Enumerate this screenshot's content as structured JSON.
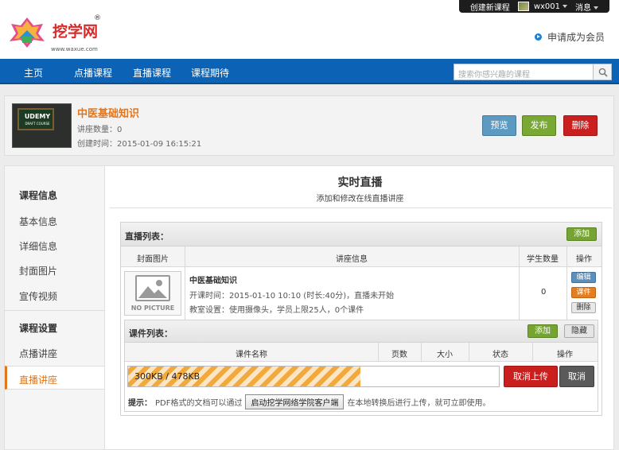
{
  "topbar": {
    "create_course": "创建新课程",
    "username": "wx001",
    "messages": "消息"
  },
  "header": {
    "logo_text": "挖学网",
    "logo_reg": "®",
    "logo_url": "www.waxue.com",
    "apply_member": "申请成为会员"
  },
  "nav": {
    "items": [
      "主页",
      "点播课程",
      "直播课程",
      "课程期待"
    ],
    "search_placeholder": "搜索你感兴趣的课程"
  },
  "course": {
    "thumb_title": "UDEMY",
    "thumb_sub": "DRAFT COURSE",
    "title": "中医基础知识",
    "lecture_count": "讲座数量：0",
    "created": "创建时间：2015-01-09 16:15:21",
    "preview": "预览",
    "publish": "发布",
    "delete": "删除"
  },
  "sidebar": {
    "info_head": "课程信息",
    "info_items": [
      "基本信息",
      "详细信息",
      "封面图片",
      "宣传视频"
    ],
    "settings_head": "课程设置",
    "settings_items": [
      "点播讲座",
      "直播讲座"
    ]
  },
  "main": {
    "title": "实时直播",
    "subtitle": "添加和修改在线直播讲座"
  },
  "live_list": {
    "title": "直播列表：",
    "add": "添加",
    "columns": [
      "封面图片",
      "讲座信息",
      "学生数量",
      "操作"
    ],
    "row": {
      "no_picture": "NO PICTURE",
      "title": "中医基础知识",
      "time": "开课时间：2015-01-10 10:10 (时长:40分)，直播未开始",
      "room": "教室设置：使用摄像头，学员上限25人，0个课件",
      "students": "0",
      "edit": "编辑",
      "courseware": "课件",
      "remove": "删除"
    }
  },
  "courseware": {
    "title": "课件列表：",
    "add": "添加",
    "hide": "隐藏",
    "columns": [
      "课件名称",
      "页数",
      "大小",
      "状态",
      "操作"
    ],
    "progress_text": "300KB / 478KB",
    "progress_fraction": 0.6276,
    "cancel_upload": "取消上传",
    "cancel": "取消",
    "tip_label": "提示：",
    "tip_before": "PDF格式的文档可以通过",
    "tip_button": "启动挖学网络学院客户端",
    "tip_after": "在本地转换后进行上传，就可立即使用。"
  },
  "colors": {
    "nav_blue": "#0c63b5",
    "accent_orange": "#e0761e",
    "green": "#75a432",
    "red": "#c9201f"
  }
}
